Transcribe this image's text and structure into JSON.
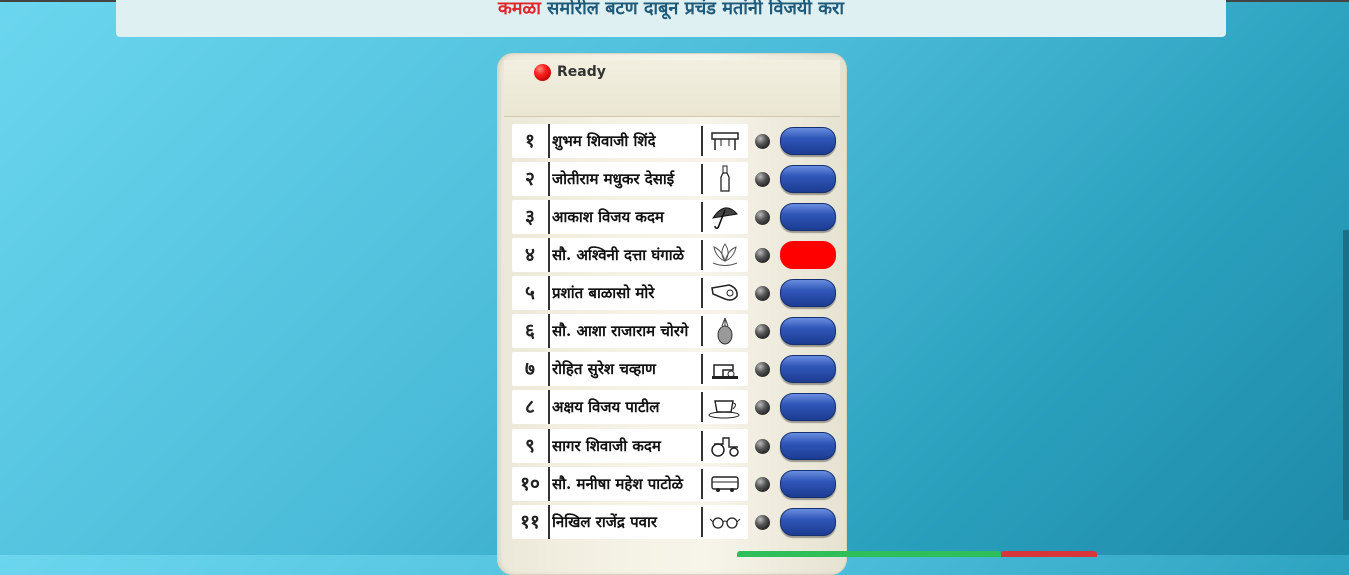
{
  "banner": {
    "highlight": "कमळा",
    "text": " समोरील बटण दाबून प्रचंड मतांनी विजयी करा"
  },
  "evm": {
    "status_label": "Ready",
    "selected_index": 3,
    "candidates": [
      {
        "num": "१",
        "name": "शुभम शिवाजी शिंदे",
        "symbol": "table-icon"
      },
      {
        "num": "२",
        "name": "जोतीराम मधुकर देसाई",
        "symbol": "bottle-icon"
      },
      {
        "num": "३",
        "name": "आकाश विजय कदम",
        "symbol": "umbrella-icon"
      },
      {
        "num": "४",
        "name": "सौ. अश्विनी दत्ता घंगाळे",
        "symbol": "lotus-icon"
      },
      {
        "num": "५",
        "name": "प्रशांत बाळासो मोरे",
        "symbol": "whistle-icon"
      },
      {
        "num": "६",
        "name": "सौ. आशा राजाराम चोरगे",
        "symbol": "pineapple-icon"
      },
      {
        "num": "७",
        "name": "रोहित सुरेश चव्हाण",
        "symbol": "sewing-machine-icon"
      },
      {
        "num": "८",
        "name": "अक्षय विजय पाटील",
        "symbol": "cup-saucer-icon"
      },
      {
        "num": "९",
        "name": "सागर शिवाजी कदम",
        "symbol": "tractor-icon"
      },
      {
        "num": "१०",
        "name": "सौ. मनीषा महेश पाटोळे",
        "symbol": "bus-icon"
      },
      {
        "num": "११",
        "name": "निखिल राजेंद्र पवार",
        "symbol": "spectacles-icon"
      }
    ]
  },
  "colors": {
    "button_blue": "#2f56b8",
    "button_selected": "#ff0000",
    "banner_highlight": "#e0262a",
    "banner_text": "#1e5a7a"
  }
}
